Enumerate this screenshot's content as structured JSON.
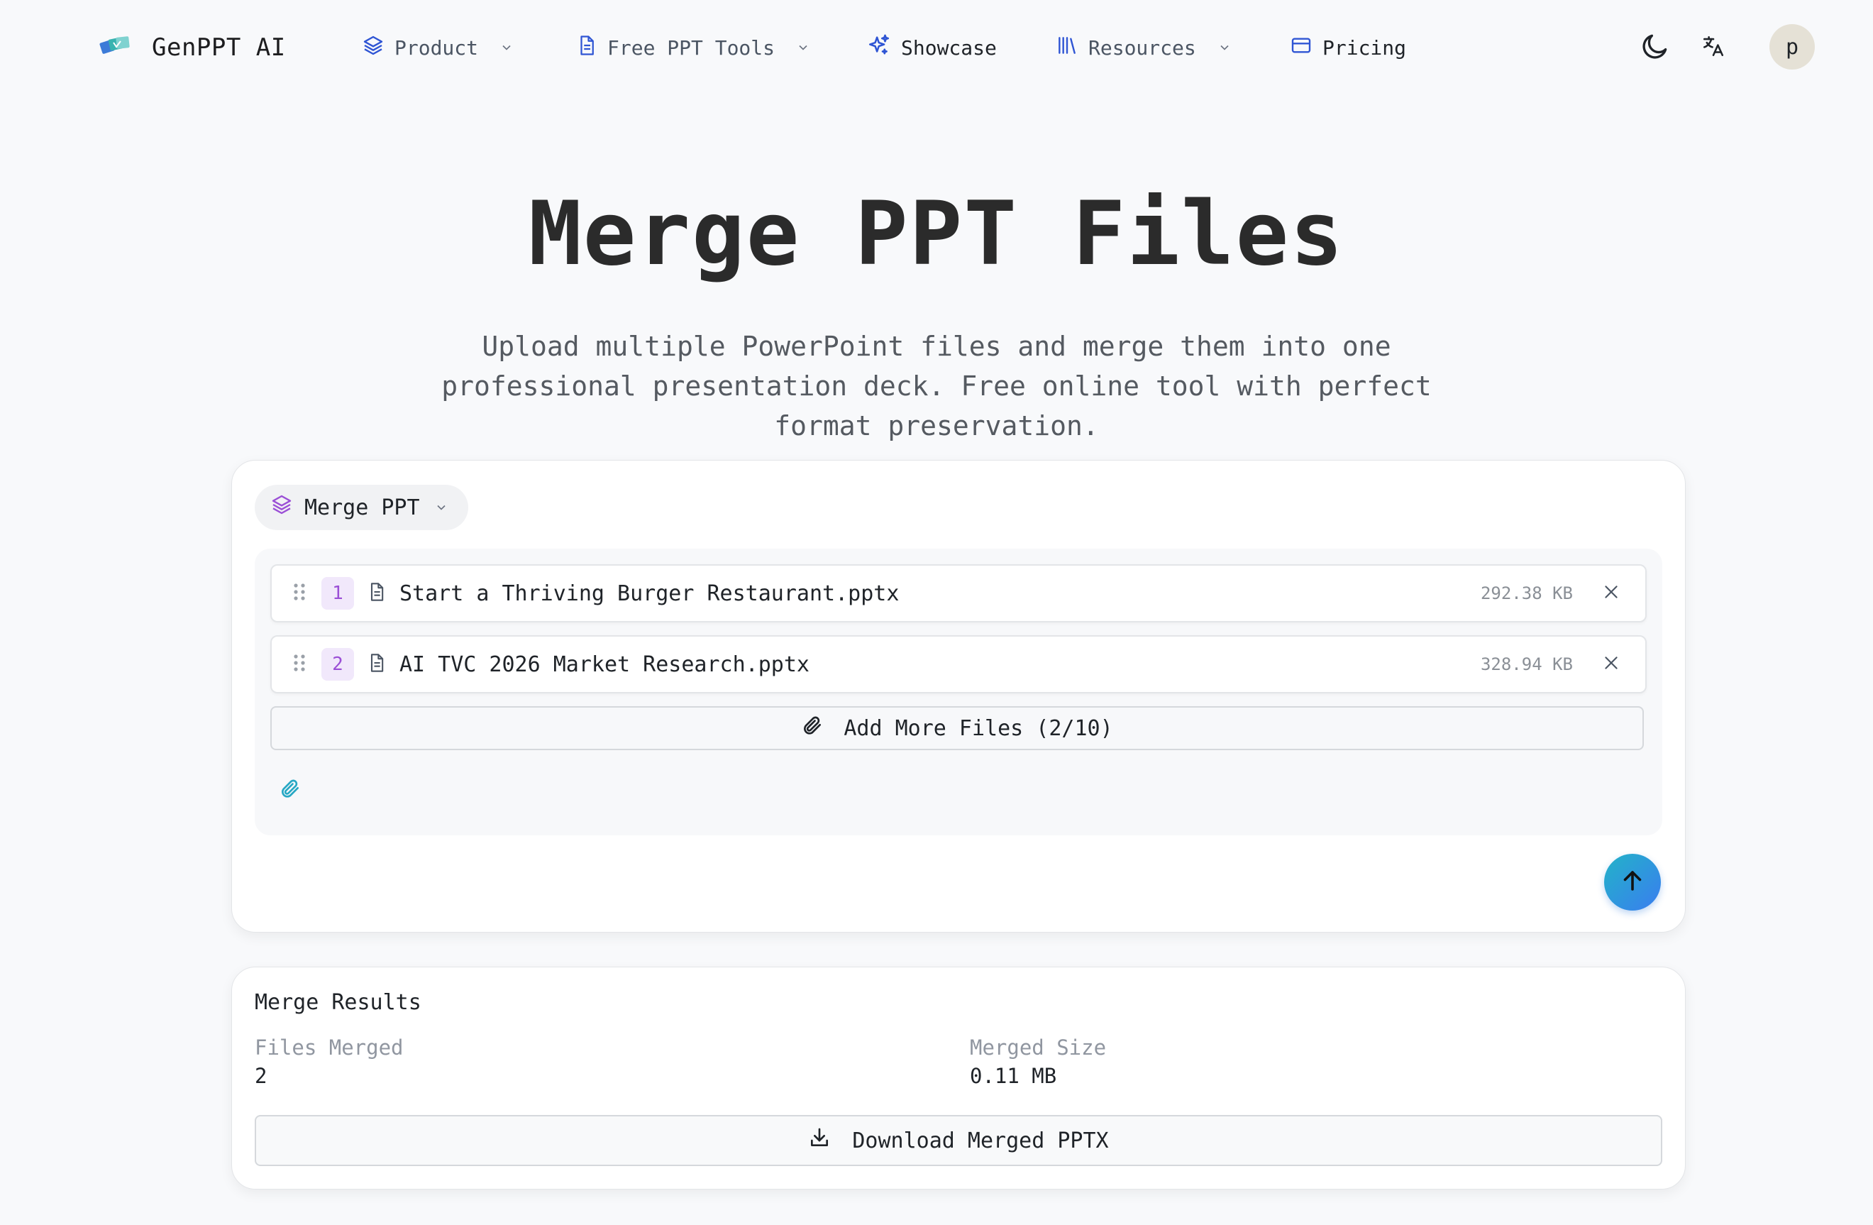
{
  "nav": {
    "brand": "GenPPT AI",
    "items": [
      {
        "label": "Product",
        "has_dropdown": true
      },
      {
        "label": "Free PPT Tools",
        "has_dropdown": true
      },
      {
        "label": "Showcase",
        "has_dropdown": false
      },
      {
        "label": "Resources",
        "has_dropdown": true
      },
      {
        "label": "Pricing",
        "has_dropdown": false
      }
    ],
    "avatar_initial": "p",
    "icons": [
      "logo-icon",
      "layers-icon",
      "document-icon",
      "sparkles-icon",
      "library-icon",
      "credit-card-icon",
      "moon-icon",
      "translate-icon"
    ]
  },
  "hero": {
    "title": "Merge PPT Files",
    "subtitle": "Upload multiple PowerPoint files and merge them into one professional presentation deck. Free online tool with perfect format preservation."
  },
  "merge": {
    "mode_label": "Merge PPT",
    "files": [
      {
        "index": "1",
        "name": "Start a Thriving Burger Restaurant.pptx",
        "size": "292.38 KB"
      },
      {
        "index": "2",
        "name": "AI TVC 2026 Market Research.pptx",
        "size": "328.94 KB"
      }
    ],
    "add_more_label": "Add More Files (2/10)"
  },
  "results": {
    "title": "Merge Results",
    "files_merged_label": "Files Merged",
    "files_merged_value": "2",
    "merged_size_label": "Merged Size",
    "merged_size_value": "0.11 MB",
    "download_label": "Download Merged PPTX"
  },
  "colors": {
    "accent_blue": "#3a7df0",
    "accent_teal": "#22b3c8",
    "badge_purple": "#9b4fd6",
    "badge_bg": "#f1e8fb",
    "nav_icon_blue": "#2f55d4"
  }
}
